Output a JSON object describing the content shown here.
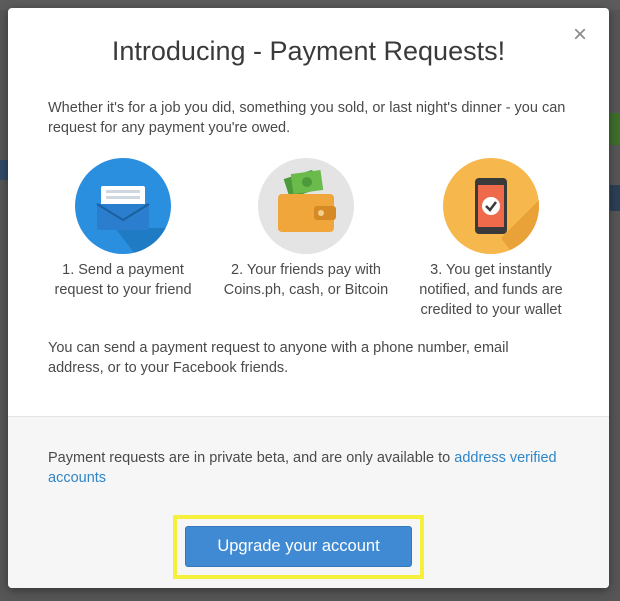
{
  "modal": {
    "title": "Introducing - Payment Requests!",
    "close_glyph": "×",
    "intro": "Whether it's for a job you did, something you sold, or last night's dinner - you can request for any payment you're owed.",
    "steps": [
      {
        "icon": "envelope-icon",
        "label": "1. Send a payment request to your friend",
        "color": "#2b8fe0"
      },
      {
        "icon": "wallet-icon",
        "label": "2. Your friends pay with Coins.ph, cash, or Bitcoin",
        "color": "#e4e4e4"
      },
      {
        "icon": "phone-check-icon",
        "label": "3. You get instantly notified, and funds are credited to your wallet",
        "color": "#f6b84c"
      }
    ],
    "note": "You can send a payment request to anyone with a phone number, email address, or to your Facebook friends.",
    "footer": {
      "beta_text": "Payment requests are in private beta, and are only available to ",
      "beta_link": "address verified accounts",
      "upgrade_label": "Upgrade your account"
    }
  },
  "colors": {
    "accent": "#3f8ad3",
    "link": "#2f86c8",
    "highlight": "#f5f03c"
  }
}
